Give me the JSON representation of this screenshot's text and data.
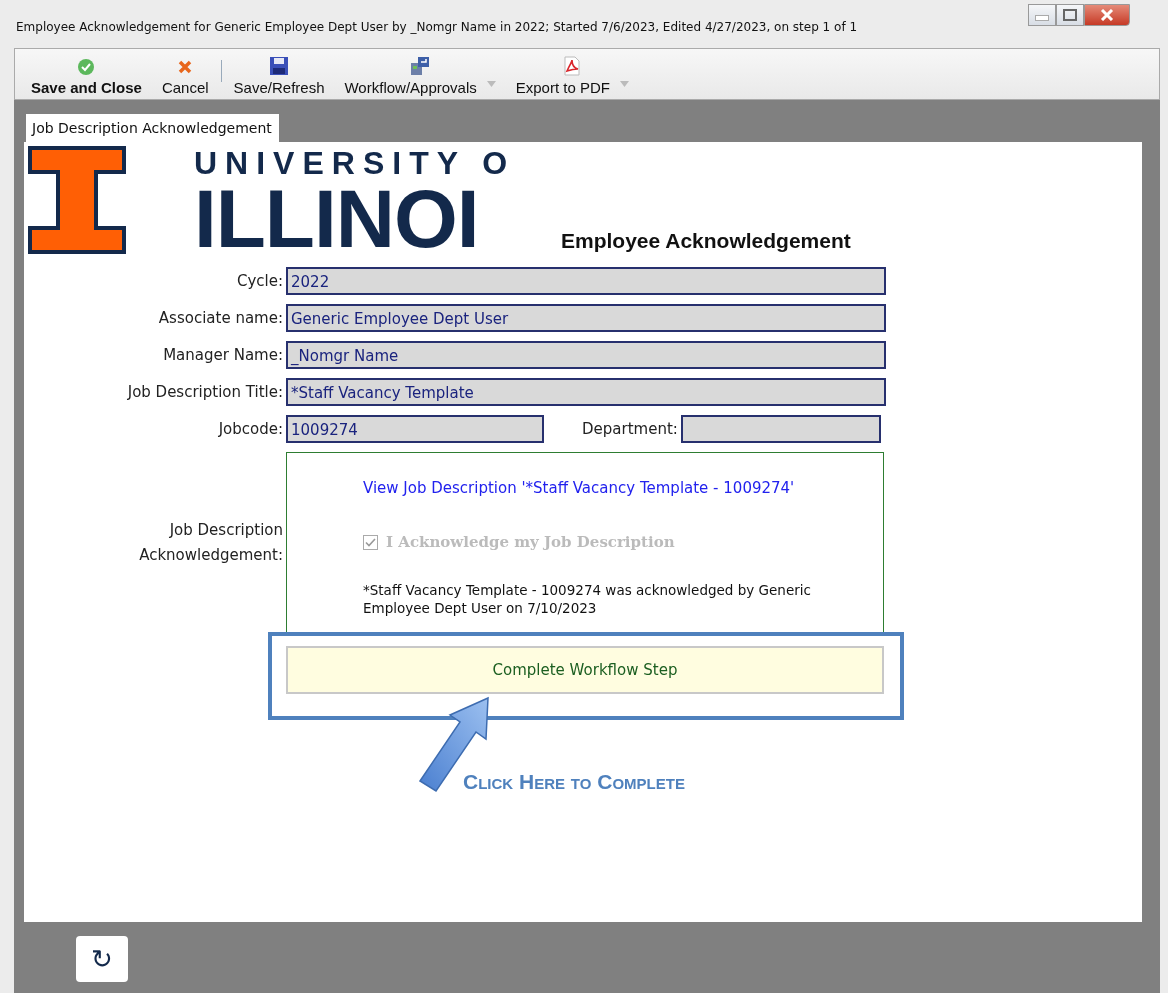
{
  "window": {
    "title": "Employee Acknowledgement for Generic Employee Dept User by _Nomgr Name in 2022; Started 7/6/2023, Edited 4/27/2023, on step 1 of 1"
  },
  "toolbar": [
    {
      "kind": "ok",
      "label": "Save and Close",
      "bold": true,
      "dropdown": false
    },
    {
      "kind": "cancel",
      "label": "Cancel",
      "bold": false,
      "dropdown": false
    },
    {
      "kind": "separator"
    },
    {
      "kind": "save",
      "label": "Save/Refresh",
      "bold": false,
      "dropdown": false
    },
    {
      "kind": "workflow",
      "label": "Workflow/Approvals",
      "bold": false,
      "dropdown": true
    },
    {
      "kind": "pdf",
      "label": "Export to PDF",
      "bold": false,
      "dropdown": true
    }
  ],
  "tabs": [
    {
      "label": "Job Description Acknowledgement",
      "selected": true
    }
  ],
  "logo": {
    "line1": "UNIVERSITY O",
    "line2": "ILLINOI"
  },
  "form": {
    "heading": "Employee Acknowledgement",
    "rows": [
      {
        "fields": [
          {
            "label": "Cycle:",
            "value": "2022"
          }
        ]
      },
      {
        "fields": [
          {
            "label": "Associate name:",
            "value": "Generic Employee Dept User"
          }
        ]
      },
      {
        "fields": [
          {
            "label": "Manager Name:",
            "value": "_Nomgr Name"
          }
        ]
      },
      {
        "fields": [
          {
            "label": "Job Description Title:",
            "value": "*Staff Vacancy Template"
          }
        ]
      },
      {
        "fields": [
          {
            "label": "Jobcode:",
            "value": "1009274"
          },
          {
            "label": "Department:"
          }
        ]
      }
    ],
    "acknowledgement": {
      "label": "Job Description Acknowledgement:",
      "link": "View Job Description '*Staff Vacancy Template - 1009274'",
      "checkbox": {
        "label": "I Acknowledge my Job Description",
        "checked": true,
        "disabled": true
      },
      "note": "*Staff Vacancy Template - 1009274 was acknowledged by Generic Employee Dept User on 7/10/2023"
    },
    "complete_button": "Complete Workflow Step"
  },
  "callout": {
    "text": "Click Here to Complete"
  },
  "refresh_button": "↻"
}
